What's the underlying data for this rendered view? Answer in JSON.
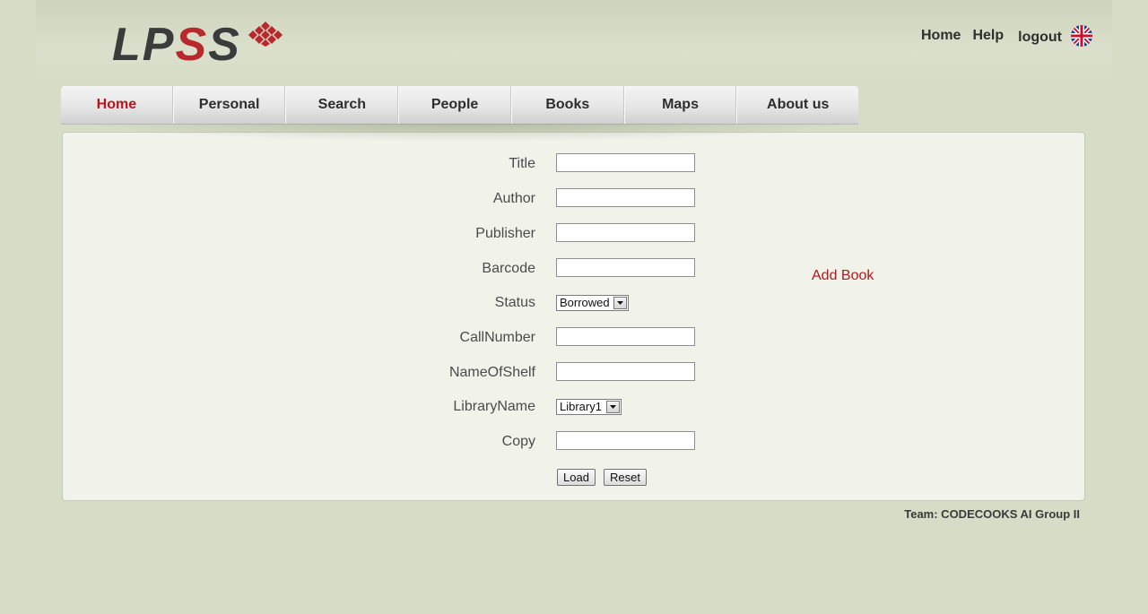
{
  "logo": {
    "text_prefix": "LP",
    "text_red": "S",
    "text_suffix": "S"
  },
  "top_links": {
    "home": "Home",
    "help": "Help",
    "logout": "logout"
  },
  "nav": {
    "items": [
      {
        "label": "Home",
        "active": true
      },
      {
        "label": "Personal"
      },
      {
        "label": "Search"
      },
      {
        "label": "People"
      },
      {
        "label": "Books"
      },
      {
        "label": "Maps"
      },
      {
        "label": "About us"
      }
    ]
  },
  "form": {
    "title_label": "Title",
    "author_label": "Author",
    "publisher_label": "Publisher",
    "barcode_label": "Barcode",
    "status_label": "Status",
    "status_value": "Borrowed",
    "callnumber_label": "CallNumber",
    "nameofshelf_label": "NameOfShelf",
    "libraryname_label": "LibraryName",
    "libraryname_value": "Library1",
    "copy_label": "Copy",
    "load_button": "Load",
    "reset_button": "Reset"
  },
  "add_book_link": "Add Book",
  "footer": {
    "team": "Team: CODECOOKS AI Group II"
  },
  "colors": {
    "accent_red": "#b8161c",
    "background": "#d6dcc6",
    "panel": "#f1f2ea"
  }
}
